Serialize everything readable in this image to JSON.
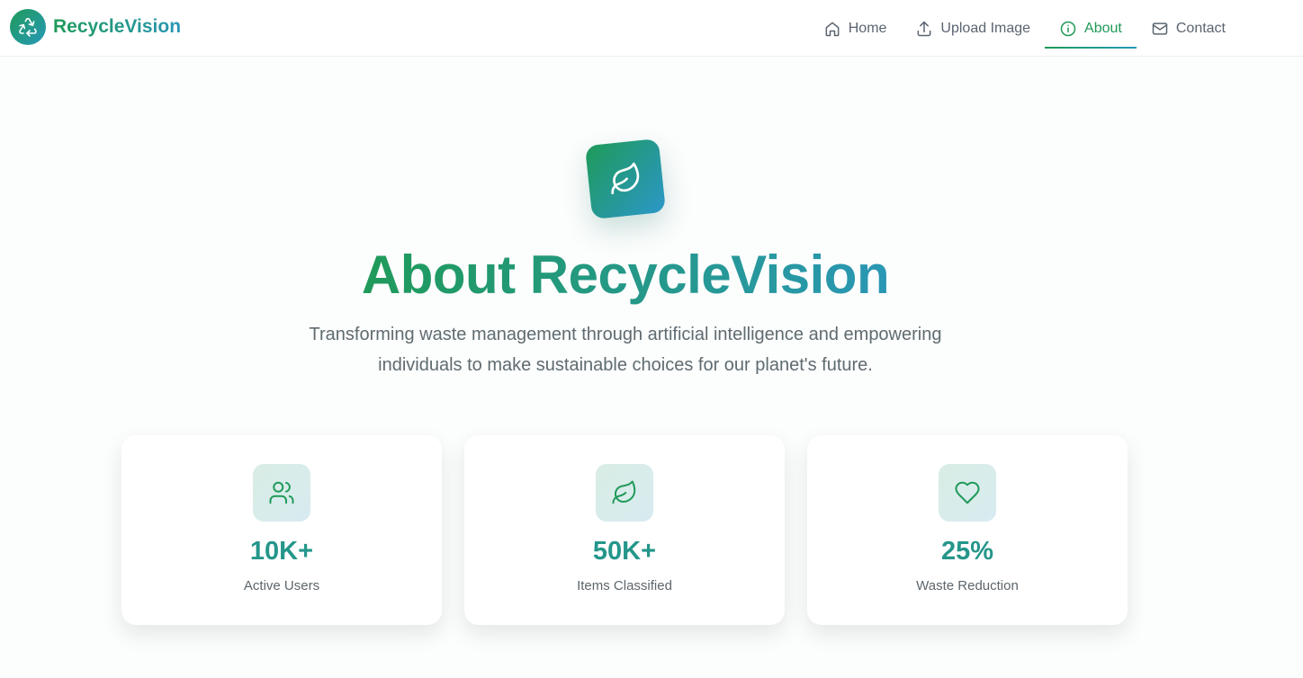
{
  "brand": {
    "name": "RecycleVision",
    "logo_icon": "recycle-icon"
  },
  "nav": [
    {
      "label": "Home",
      "icon": "home-icon",
      "active": false
    },
    {
      "label": "Upload Image",
      "icon": "upload-icon",
      "active": false
    },
    {
      "label": "About",
      "icon": "info-icon",
      "active": true
    },
    {
      "label": "Contact",
      "icon": "mail-icon",
      "active": false
    }
  ],
  "hero": {
    "icon": "leaf-icon",
    "title": "About RecycleVision",
    "subtitle_line1": "Transforming waste management through artificial intelligence and empowering",
    "subtitle_line2": "individuals to make sustainable choices for our planet's future."
  },
  "stats": [
    {
      "value": "10K+",
      "label": "Active Users",
      "icon": "users-icon"
    },
    {
      "value": "50K+",
      "label": "Items Classified",
      "icon": "leaf-icon"
    },
    {
      "value": "25%",
      "label": "Waste Reduction",
      "icon": "heart-icon"
    }
  ],
  "colors": {
    "brand_green": "#1f9a59",
    "brand_teal": "#2799b8",
    "stat_value": "#25968a"
  }
}
